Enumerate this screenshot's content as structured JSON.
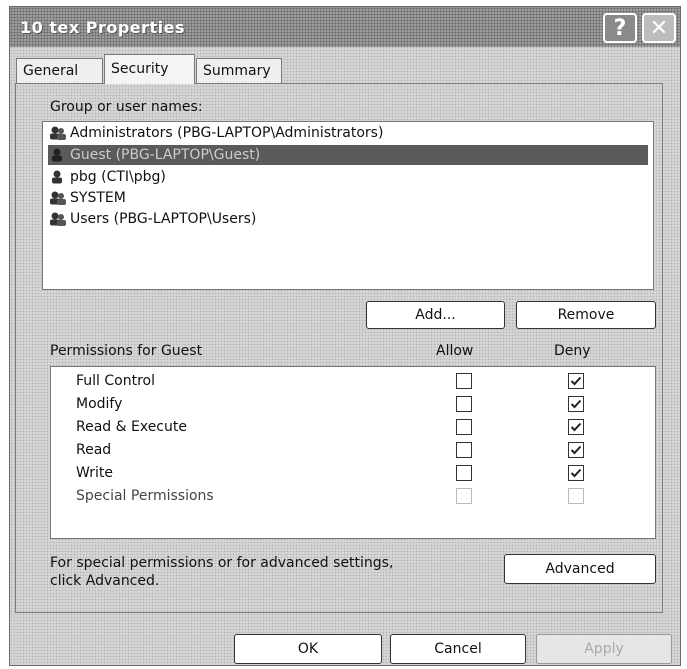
{
  "window": {
    "title": "10 tex Properties",
    "help_label": "?",
    "close_label": "✕"
  },
  "tabs": [
    {
      "label": "General",
      "active": false
    },
    {
      "label": "Security",
      "active": true
    },
    {
      "label": "Summary",
      "active": false
    }
  ],
  "groups": {
    "label": "Group or user names:",
    "items": [
      {
        "name": "Administrators (PBG-LAPTOP\\Administrators)",
        "icon": "group-icon",
        "selected": false
      },
      {
        "name": "Guest (PBG-LAPTOP\\Guest)",
        "icon": "user-icon",
        "selected": true
      },
      {
        "name": "pbg (CTI\\pbg)",
        "icon": "user-icon",
        "selected": false
      },
      {
        "name": "SYSTEM",
        "icon": "group-icon",
        "selected": false
      },
      {
        "name": "Users (PBG-LAPTOP\\Users)",
        "icon": "group-icon",
        "selected": false
      }
    ],
    "add_label": "Add...",
    "remove_label": "Remove"
  },
  "permissions": {
    "title": "Permissions for Guest",
    "allow_header": "Allow",
    "deny_header": "Deny",
    "rows": [
      {
        "name": "Full Control",
        "allow": false,
        "deny": true,
        "enabled": true
      },
      {
        "name": "Modify",
        "allow": false,
        "deny": true,
        "enabled": true
      },
      {
        "name": "Read & Execute",
        "allow": false,
        "deny": true,
        "enabled": true
      },
      {
        "name": "Read",
        "allow": false,
        "deny": true,
        "enabled": true
      },
      {
        "name": "Write",
        "allow": false,
        "deny": true,
        "enabled": true
      },
      {
        "name": "Special Permissions",
        "allow": false,
        "deny": false,
        "enabled": false
      }
    ]
  },
  "advanced": {
    "note_line1": "For special permissions or for advanced settings,",
    "note_line2": "click Advanced.",
    "button_label": "Advanced"
  },
  "footer": {
    "ok_label": "OK",
    "cancel_label": "Cancel",
    "apply_label": "Apply"
  }
}
